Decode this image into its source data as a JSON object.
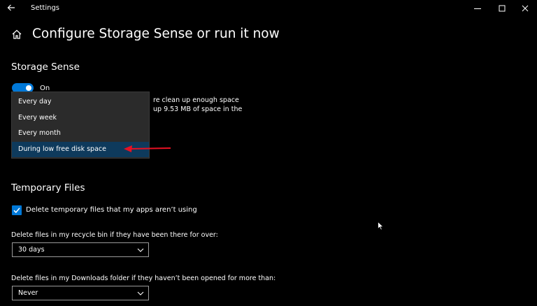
{
  "titlebar": {
    "app_title": "Settings",
    "icons": {
      "back": "back-arrow-icon",
      "minimize": "minimize-icon",
      "maximize": "maximize-icon",
      "close": "close-icon"
    }
  },
  "header": {
    "title": "Configure Storage Sense or run it now",
    "icon": "home-icon"
  },
  "storage_sense": {
    "title": "Storage Sense",
    "toggle_label": "On",
    "toggle_state": true,
    "desc_line1_fragment": "re clean up enough space",
    "desc_line2_fragment": "up 9.53 MB of space in the"
  },
  "run_schedule_menu": {
    "options": [
      "Every day",
      "Every week",
      "Every month",
      "During low free disk space"
    ],
    "selected_index": 3
  },
  "annotation": {
    "arrow_color": "#e81123"
  },
  "temporary_files": {
    "title": "Temporary Files",
    "checkbox_label": "Delete temporary files that my apps aren’t using",
    "checkbox_checked": true,
    "recycle_label": "Delete files in my recycle bin if they have been there for over:",
    "recycle_value": "30 days",
    "downloads_label": "Delete files in my Downloads folder if they haven’t been opened for more than:",
    "downloads_value": "Never"
  },
  "colors": {
    "accent": "#0078d7",
    "background": "#000000",
    "menu_background": "#2b2b2b",
    "menu_selected": "#0e3a5c"
  }
}
